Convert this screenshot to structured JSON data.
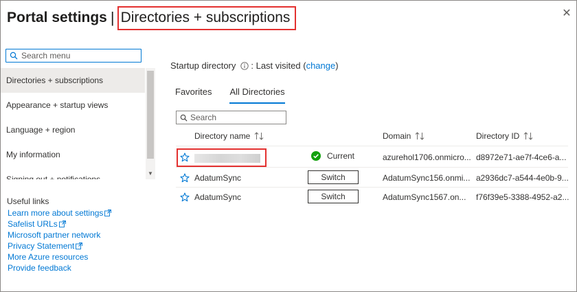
{
  "title": {
    "main": "Portal settings",
    "separator": "|",
    "sub": "Directories + subscriptions"
  },
  "colors": {
    "accent": "#0078d4",
    "highlight": "#e3302f",
    "success": "#13a10e",
    "active_bg": "#edebe9"
  },
  "sidebar": {
    "search_placeholder": "Search menu",
    "items": [
      {
        "label": "Directories + subscriptions",
        "active": true
      },
      {
        "label": "Appearance + startup views"
      },
      {
        "label": "Language + region"
      },
      {
        "label": "My information"
      },
      {
        "label": "Signing out + notifications"
      }
    ],
    "useful_title": "Useful links",
    "links": [
      {
        "label": "Learn more about settings",
        "external": true
      },
      {
        "label": "Safelist URLs",
        "external": true
      },
      {
        "label": "Microsoft partner network",
        "external": false
      },
      {
        "label": "Privacy Statement",
        "external": true
      },
      {
        "label": "More Azure resources",
        "external": false
      },
      {
        "label": "Provide feedback",
        "external": false
      }
    ]
  },
  "startup": {
    "label": "Startup directory",
    "value": ": Last visited (",
    "link": "change",
    "close": ")"
  },
  "tabs": [
    {
      "label": "Favorites"
    },
    {
      "label": "All Directories",
      "active": true
    }
  ],
  "search": {
    "placeholder": "Search"
  },
  "table": {
    "columns": [
      "Directory name",
      "Domain",
      "Directory ID"
    ],
    "rows": [
      {
        "name": "",
        "status": "Current",
        "domain": "azurehol1706.onmicro...",
        "id": "d8972e71-ae7f-4ce6-a..."
      },
      {
        "name": "AdatumSync",
        "action": "Switch",
        "domain": "AdatumSync156.onmi...",
        "id": "a2936dc7-a544-4e0b-9..."
      },
      {
        "name": "AdatumSync",
        "action": "Switch",
        "domain": "AdatumSync1567.on...",
        "id": "f76f39e5-3388-4952-a2..."
      }
    ]
  }
}
